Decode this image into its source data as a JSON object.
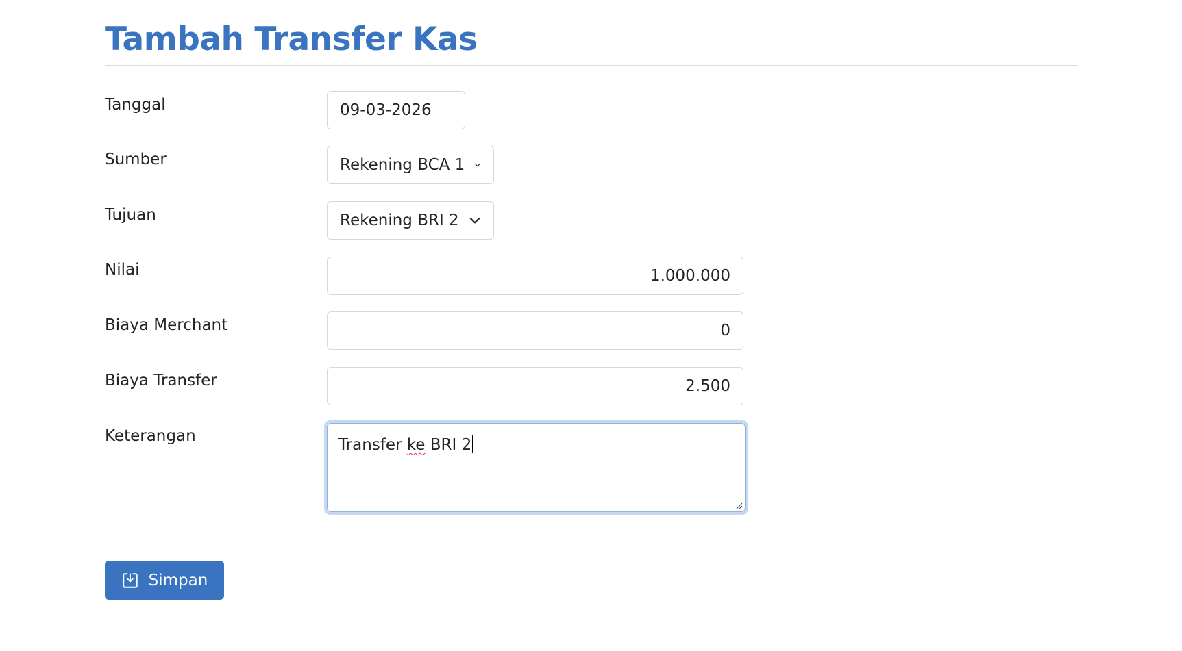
{
  "page": {
    "title": "Tambah Transfer Kas"
  },
  "form": {
    "tanggal": {
      "label": "Tanggal",
      "value": "09-03-2026"
    },
    "sumber": {
      "label": "Sumber",
      "value": "Rekening BCA 1"
    },
    "tujuan": {
      "label": "Tujuan",
      "value": "Rekening BRI 2"
    },
    "nilai": {
      "label": "Nilai",
      "value": "1.000.000"
    },
    "biaya_merchant": {
      "label": "Biaya Merchant",
      "value": "0"
    },
    "biaya_transfer": {
      "label": "Biaya Transfer",
      "value": "2.500"
    },
    "keterangan": {
      "label": "Keterangan",
      "value_before": "Transfer ",
      "value_misspelled": "ke",
      "value_after": " BRI 2"
    }
  },
  "actions": {
    "save_label": "Simpan"
  },
  "icons": {
    "select_indicator": "chevron-down-icon",
    "save": "save-download-icon"
  },
  "colors": {
    "accent": "#3a74c0",
    "focus_ring": "#c7d8ee"
  }
}
